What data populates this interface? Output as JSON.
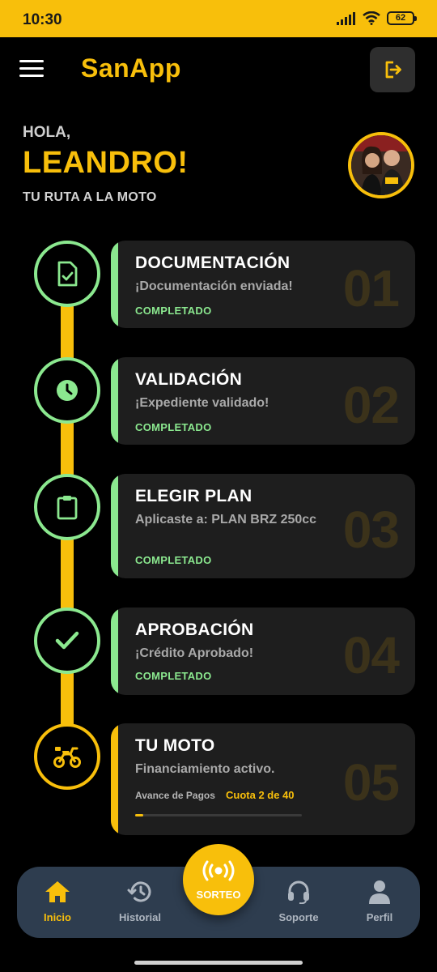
{
  "status_bar": {
    "time": "10:30",
    "battery": "62",
    "bar_color": "#F8BF0B"
  },
  "header": {
    "app_title": "SanApp",
    "menu_icon": "hamburger-menu-icon",
    "logout_icon": "logout-icon"
  },
  "greeting": {
    "hello": "HOLA,",
    "name": "LEANDRO!",
    "subtitle": "TU RUTA A LA MOTO"
  },
  "steps": [
    {
      "number": "01",
      "title": "DOCUMENTACIÓN",
      "description": "¡Documentación enviada!",
      "status": "COMPLETADO",
      "icon": "document-check-icon"
    },
    {
      "number": "02",
      "title": "VALIDACIÓN",
      "description": "¡Expediente validado!",
      "status": "COMPLETADO",
      "icon": "pie-chart-icon"
    },
    {
      "number": "03",
      "title": "ELEGIR PLAN",
      "description": "Aplicaste a: PLAN BRZ 250cc",
      "status": "COMPLETADO",
      "icon": "clipboard-icon"
    },
    {
      "number": "04",
      "title": "APROBACIÓN",
      "description": "¡Crédito Aprobado!",
      "status": "COMPLETADO",
      "icon": "checkmark-icon"
    },
    {
      "number": "05",
      "title": "TU MOTO",
      "description": "Financiamiento activo.",
      "payment_label": "Avance de Pagos",
      "payment_value": "Cuota 2 de 40",
      "payment_progress": 0.05,
      "icon": "motorcycle-icon"
    }
  ],
  "colors": {
    "accent": "#F8BF0B",
    "completed": "#8BE88F",
    "card": "#1e1e1e",
    "nav": "#2e3d4f"
  },
  "bottom_nav": {
    "items": [
      {
        "label": "Inicio",
        "icon": "home-icon",
        "active": true
      },
      {
        "label": "Historial",
        "icon": "history-icon",
        "active": false
      },
      {
        "label": "Soporte",
        "icon": "headset-icon",
        "active": false
      },
      {
        "label": "Perfil",
        "icon": "user-icon",
        "active": false
      }
    ],
    "center_button": {
      "label": "SORTEO",
      "icon": "broadcast-icon"
    }
  }
}
